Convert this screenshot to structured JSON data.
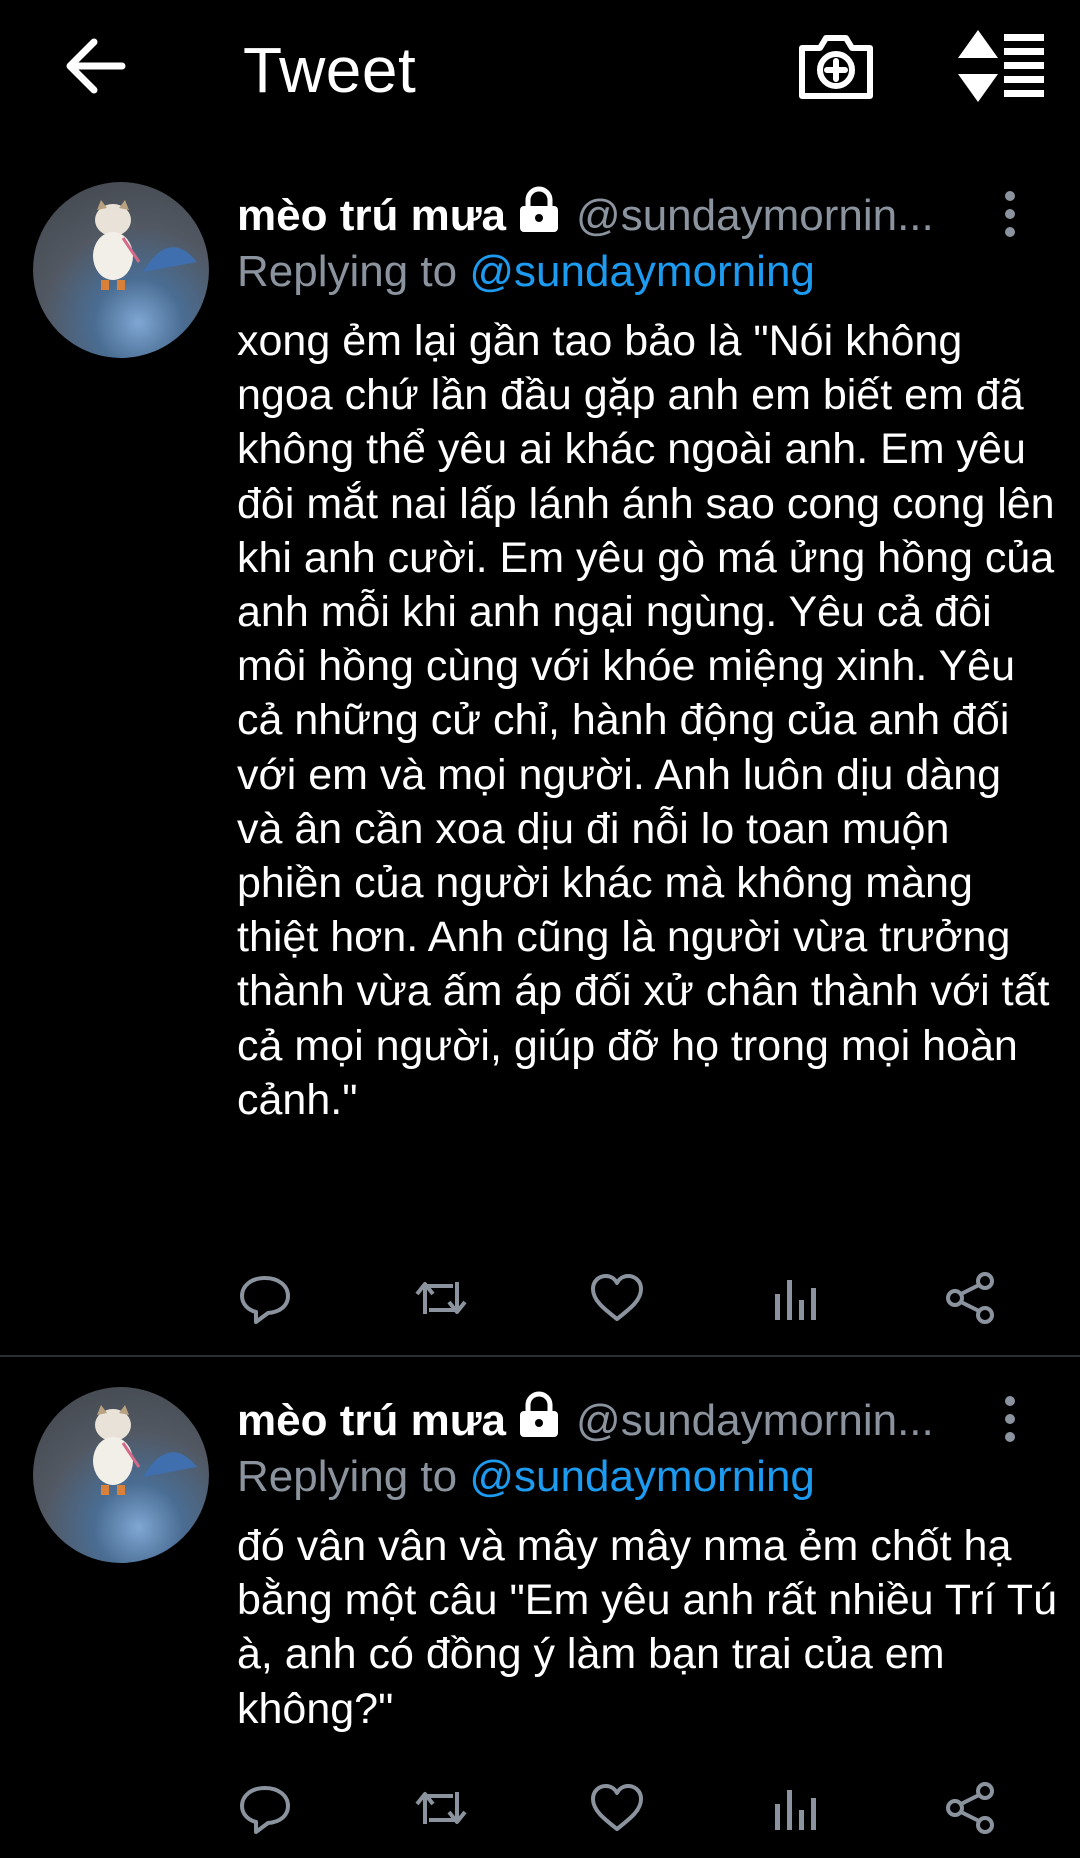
{
  "header": {
    "title": "Tweet",
    "icons": {
      "back": "arrow-left-icon",
      "camera": "camera-add-icon",
      "sort": "sort-list-icon"
    }
  },
  "colors": {
    "background": "#000000",
    "accent": "#1d9bf0",
    "muted": "#8b949e",
    "divider": "#2a2f34"
  },
  "tweets": [
    {
      "name": "mèo trú mưa",
      "handle": "@sundaymornin...",
      "replying_label": "Replying to",
      "replying_to": "@sundaymorning",
      "text": "xong ẻm lại gần tao bảo là \"Nói không ngoa chứ lần đầu gặp anh em biết em đã không thể yêu ai khác ngoài anh. Em yêu đôi mắt nai lấp lánh ánh sao cong cong lên khi anh cười. Em yêu gò má ửng hồng của anh mỗi khi anh ngại ngùng. Yêu cả đôi môi hồng cùng với khóe miệng xinh. Yêu cả những cử chỉ, hành động của anh đối với em và mọi người. Anh luôn dịu dàng và ân cần  xoa dịu đi nỗi lo toan muộn phiền của người khác mà không màng thiệt hơn. Anh cũng là người vừa trưởng thành vừa ấm áp đối xử chân thành với tất cả mọi người, giúp đỡ họ trong mọi hoàn cảnh.\""
    },
    {
      "name": "mèo trú mưa",
      "handle": "@sundaymornin...",
      "replying_label": "Replying to",
      "replying_to": "@sundaymorning",
      "text": "đó vân vân và mây mây nma ẻm chốt hạ bằng một câu \"Em yêu anh rất nhiều Trí Tú à, anh có đồng ý làm bạn trai của em không?\""
    }
  ]
}
